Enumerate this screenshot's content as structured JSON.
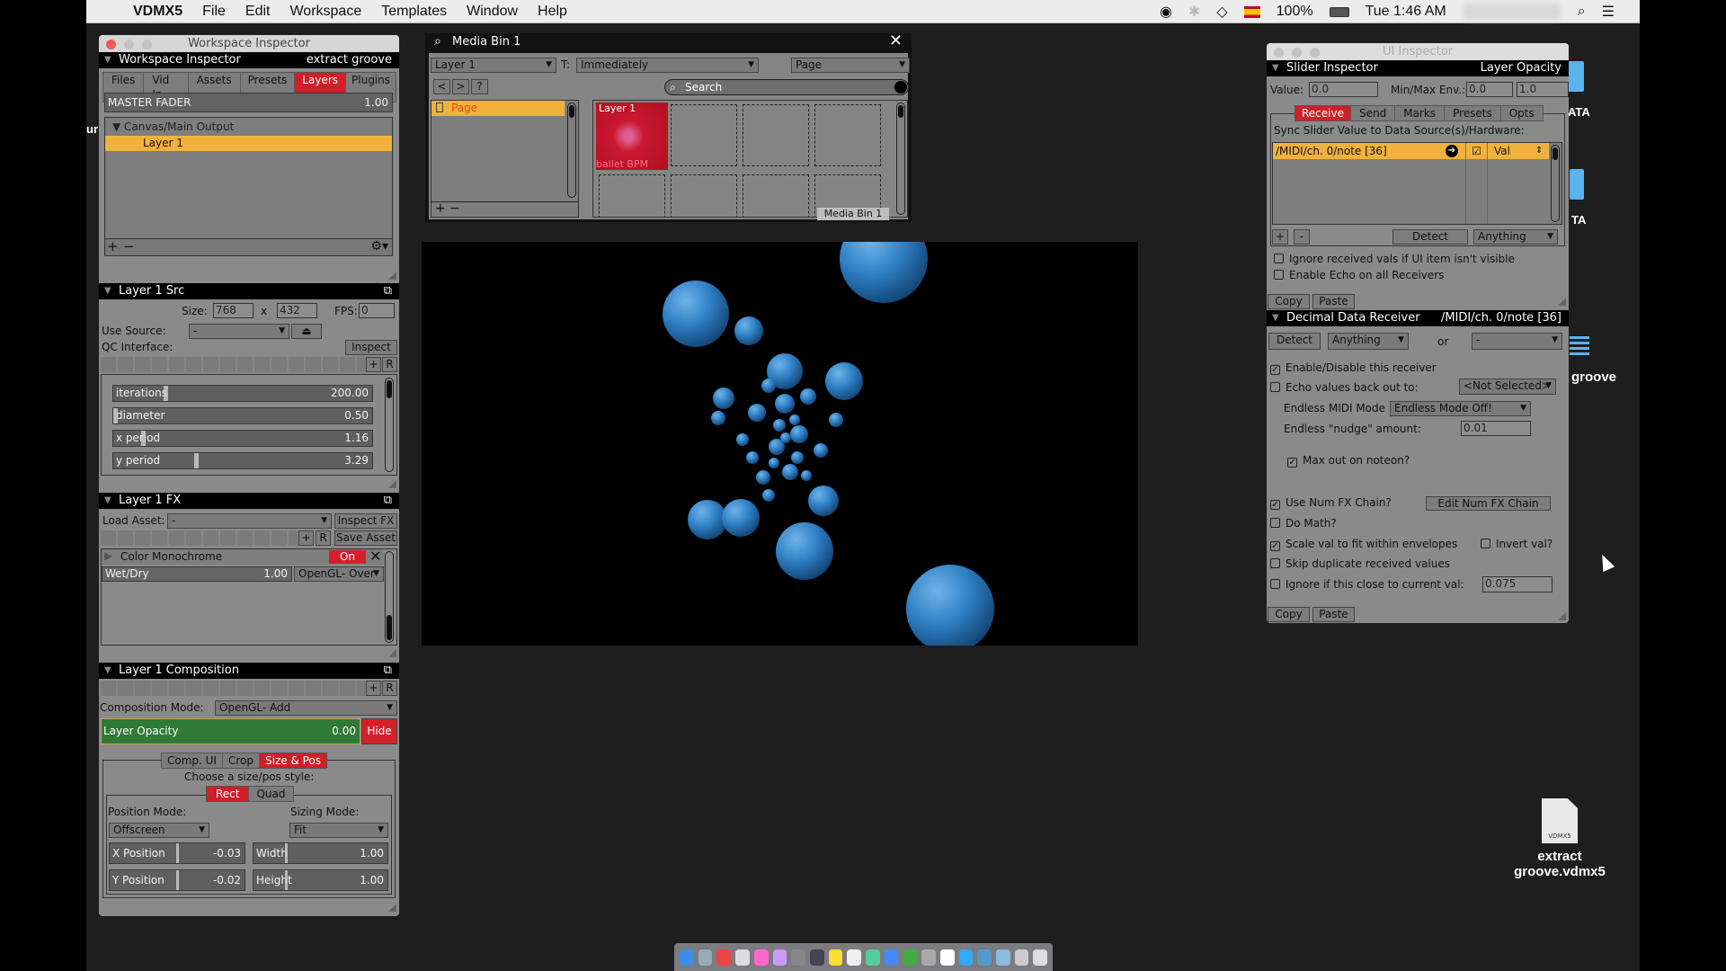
{
  "menubar": {
    "app": "VDMX5",
    "items": [
      "File",
      "Edit",
      "Workspace",
      "Templates",
      "Window",
      "Help"
    ],
    "battery": "100%",
    "clock": "Tue 1:46 AM"
  },
  "workspace": {
    "window_title": "Workspace Inspector",
    "header": "Workspace Inspector",
    "project": "extract groove",
    "tabs": [
      "Files",
      "Vid In",
      "Assets",
      "Presets",
      "Layers",
      "Plugins"
    ],
    "active_tab": "Layers",
    "master_fader": {
      "label": "MASTER FADER",
      "value": "1.00"
    },
    "tree": {
      "group": "Canvas/Main Output",
      "selected": "Layer 1"
    }
  },
  "src": {
    "header": "Layer 1 Src",
    "size_label": "Size:",
    "width": "768",
    "x": "x",
    "height": "432",
    "fps_label": "FPS:",
    "fps": "0",
    "use_source_label": "Use Source:",
    "use_source": "-",
    "qc_label": "QC Interface:",
    "inspect": "Inspect",
    "plus": "+",
    "r": "R",
    "params": [
      {
        "label": "iterations",
        "value": "200.00",
        "pos": 0.2
      },
      {
        "label": "diameter",
        "value": "0.50",
        "pos": 0.0
      },
      {
        "label": "x period",
        "value": "1.16",
        "pos": 0.11
      },
      {
        "label": "y period",
        "value": "3.29",
        "pos": 0.32
      }
    ]
  },
  "fx": {
    "header": "Layer 1 FX",
    "load_label": "Load Asset:",
    "load_value": "-",
    "inspect": "Inspect FX",
    "save": "Save Asset",
    "plus": "+",
    "r": "R",
    "effect": {
      "name": "Color Monochrome",
      "on": "On",
      "wetdry_label": "Wet/Dry",
      "wetdry": "1.00",
      "blend": "OpenGL- Over"
    }
  },
  "comp": {
    "header": "Layer 1 Composition",
    "mode_label": "Composition Mode:",
    "mode": "OpenGL- Add",
    "plus": "+",
    "r": "R",
    "opacity": {
      "label": "Layer Opacity",
      "value": "0.00",
      "hide": "Hide"
    },
    "tabs": [
      "Comp. UI",
      "Crop",
      "Size & Pos"
    ],
    "active_tab": "Size & Pos",
    "choose": "Choose a size/pos style:",
    "styles": [
      "Rect",
      "Quad"
    ],
    "active_style": "Rect",
    "position_mode_label": "Position Mode:",
    "position_mode": "Offscreen",
    "sizing_mode_label": "Sizing Mode:",
    "sizing_mode": "Fit",
    "x_pos": {
      "label": "X Position",
      "value": "-0.03"
    },
    "y_pos": {
      "label": "Y Position",
      "value": "-0.02"
    },
    "width": {
      "label": "Width",
      "value": "1.00"
    },
    "height": {
      "label": "Height",
      "value": "1.00"
    }
  },
  "mediabin": {
    "title": "Media Bin 1",
    "layer": "Layer 1",
    "t_label": "T:",
    "trigger": "Immediately",
    "page_select": "Page",
    "nav": [
      "<",
      ">",
      "?"
    ],
    "search_placeholder": "Search",
    "pages": [
      "Page"
    ],
    "clip": {
      "title": "Layer 1",
      "name": "ballet BPM"
    },
    "tab": "Media Bin 1",
    "plus": "+",
    "minus": "−"
  },
  "uiinspector": {
    "window_title": "UI Inspector",
    "header": "Slider Inspector",
    "target": "Layer Opacity",
    "value_label": "Value:",
    "value": "0.0",
    "minmax_label": "Min/Max Env.:",
    "min": "0.0",
    "max": "1.0",
    "tabs": [
      "Receive",
      "Send",
      "Marks",
      "Presets",
      "Opts"
    ],
    "active_tab": "Receive",
    "sync_label": "Sync Slider Value to Data Source(s)/Hardware:",
    "receiver": {
      "address": "/MIDI/ch. 0/note [36]",
      "enabled": true,
      "mode": "Val"
    },
    "plus": "+",
    "minus": "-",
    "detect": "Detect",
    "anything": "Anything",
    "ignore_invisible": {
      "label": "Ignore received vals if UI item isn't visible",
      "checked": false
    },
    "enable_echo": {
      "label": "Enable Echo on all Receivers",
      "checked": false
    },
    "copy": "Copy",
    "paste": "Paste"
  },
  "receiver": {
    "header": "Decimal Data Receiver",
    "address": "/MIDI/ch. 0/note [36]",
    "detect": "Detect",
    "anything": "Anything",
    "or": "or",
    "alt": "-",
    "enable": {
      "label": "Enable/Disable this receiver",
      "checked": true
    },
    "echo": {
      "label": "Echo values back out to:",
      "checked": false,
      "target": "<Not Selected>"
    },
    "endless_label": "Endless MIDI Mode",
    "endless": "Endless Mode Off!",
    "nudge_label": "Endless \"nudge\" amount:",
    "nudge": "0.01",
    "maxout": {
      "label": "Max out on noteon?",
      "checked": true
    },
    "numfx": {
      "label": "Use Num FX Chain?",
      "checked": true
    },
    "edit_numfx": "Edit Num FX Chain",
    "math": {
      "label": "Do Math?",
      "checked": false
    },
    "scale": {
      "label": "Scale val to fit within envelopes",
      "checked": true
    },
    "invert": {
      "label": "Invert val?",
      "checked": false
    },
    "skip": {
      "label": "Skip duplicate received values",
      "checked": false
    },
    "ignore_close": {
      "label": "Ignore if this close to current val:",
      "checked": false,
      "value": "0.075"
    },
    "copy": "Copy",
    "paste": "Paste"
  },
  "desktop": {
    "file_name_1": "extract",
    "file_name_2": "groove.vdmx5",
    "file_badge": "VDMX5",
    "partial_1": "ATA",
    "partial_2": "TA",
    "partial_3": "groove",
    "partial_left": "ur"
  }
}
